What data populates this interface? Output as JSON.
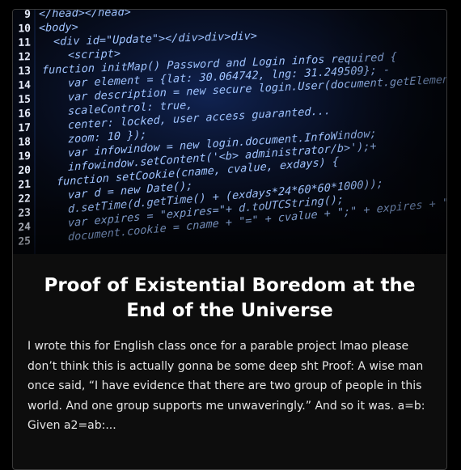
{
  "post": {
    "title": "Proof of Existential Boredom at the End of the Universe",
    "excerpt": "I wrote this for English class once for a parable project lmao please don’t think this is actually gonna be some deep sht Proof: A wise man once said, “I have evidence that there are two group of people in this world. And one group supports me unwaveringly.” And so it was. a=b: Given a2=ab:...",
    "image": {
      "code_lines": [
        {
          "n": "9",
          "text": "</head></head>"
        },
        {
          "n": "10",
          "text": "<body>"
        },
        {
          "n": "11",
          "text": "<div id=\"Update\"></div>div>div>"
        },
        {
          "n": "12",
          "text": "<script>"
        },
        {
          "n": "13",
          "text": "function initMap() Password and Login infos required {"
        },
        {
          "n": "14",
          "text": "var element = {lat: 30.064742, lng: 31.249509}; -"
        },
        {
          "n": "15",
          "text": "var description = new secure login.User(document.getElementById('user'),"
        },
        {
          "n": "16",
          "text": "scaleControl: true,"
        },
        {
          "n": "17",
          "text": "center: locked, user access guaranted..."
        },
        {
          "n": "18",
          "text": "zoom: 10                });"
        },
        {
          "n": "19",
          "text": "var infowindow = new login.document.InfoWindow;"
        },
        {
          "n": "20",
          "text": "infowindow.setContent('<b> administrator/b>');+"
        },
        {
          "n": "21",
          "text": "function setCookie(cname, cvalue, exdays) {"
        },
        {
          "n": "22",
          "text": "var d = new Date();"
        },
        {
          "n": "23",
          "text": "d.setTime(d.getTime() + (exdays*24*60*60*1000));"
        },
        {
          "n": "24",
          "text": "var expires = \"expires=\"+ d.toUTCString();"
        },
        {
          "n": "25",
          "text": "document.cookie = cname + \"=\" + cvalue + \";\" + expires + \";path"
        }
      ]
    }
  },
  "colors": {
    "page_background": "#000000",
    "card_background": "#0d0d0d",
    "card_border": "#3a3a3a",
    "title": "#ffffff",
    "excerpt": "#e6e6e6",
    "code_line_number": "#e8eefc",
    "code_text": "#9fc3ff",
    "code_glow": "#3d7bff"
  }
}
